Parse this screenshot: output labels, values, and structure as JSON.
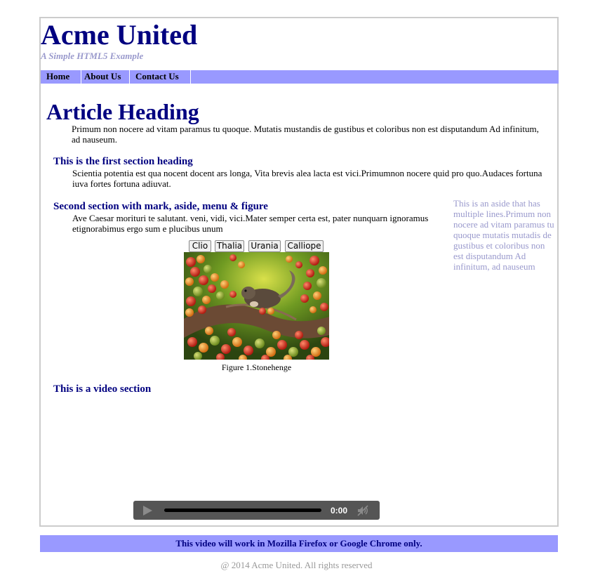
{
  "header": {
    "title": "Acme United",
    "tagline": "A Simple HTML5 Example"
  },
  "nav": {
    "items": [
      {
        "label": "Home"
      },
      {
        "label": "About Us"
      },
      {
        "label": "Contact Us"
      }
    ]
  },
  "article": {
    "heading": "Article Heading",
    "intro": "Primum non nocere ad vitam paramus tu quoque. Mutatis mustandis de gustibus et coloribus non est disputandum Ad infinitum, ad nauseum.",
    "sections": [
      {
        "heading": "This is the first section heading",
        "body": "Scientia potentia est qua nocent docent ars longa, Vita brevis alea lacta est vici.Primumnon nocere quid pro quo.Audaces fortuna iuva fortes fortuna adiuvat."
      },
      {
        "heading": "Second section with mark, aside, menu & figure",
        "body": "Ave Caesar morituri te salutant. veni, vidi, vici.Mater semper certa est, pater nunquarn ignoramus etignorabimus ergo sum e plucibus unum"
      },
      {
        "heading": "This is a video section"
      }
    ],
    "aside": "This is an aside that has multiple lines.Primum non nocere ad vitam paramus tu quoque mutatis mutadis de gustibus et coloribus non est disputandum Ad infinitum, ad nauseum",
    "menu": [
      {
        "label": "Clio"
      },
      {
        "label": "Thalia"
      },
      {
        "label": "Urania"
      },
      {
        "label": "Calliope"
      }
    ],
    "figure": {
      "caption": "Figure 1.Stonehenge"
    }
  },
  "video": {
    "time": "0:00",
    "progress": 0,
    "play_icon": "play-icon",
    "mute_icon": "muted-speaker-icon"
  },
  "footer": {
    "notice": "This video will work in Mozilla Firefox or Google Chrome only.",
    "copyright": "@ 2014 Acme United. All rights reserved"
  },
  "colors": {
    "brand_navy": "#000080",
    "nav_background": "#9999ff",
    "aside_text": "#9999cc"
  }
}
